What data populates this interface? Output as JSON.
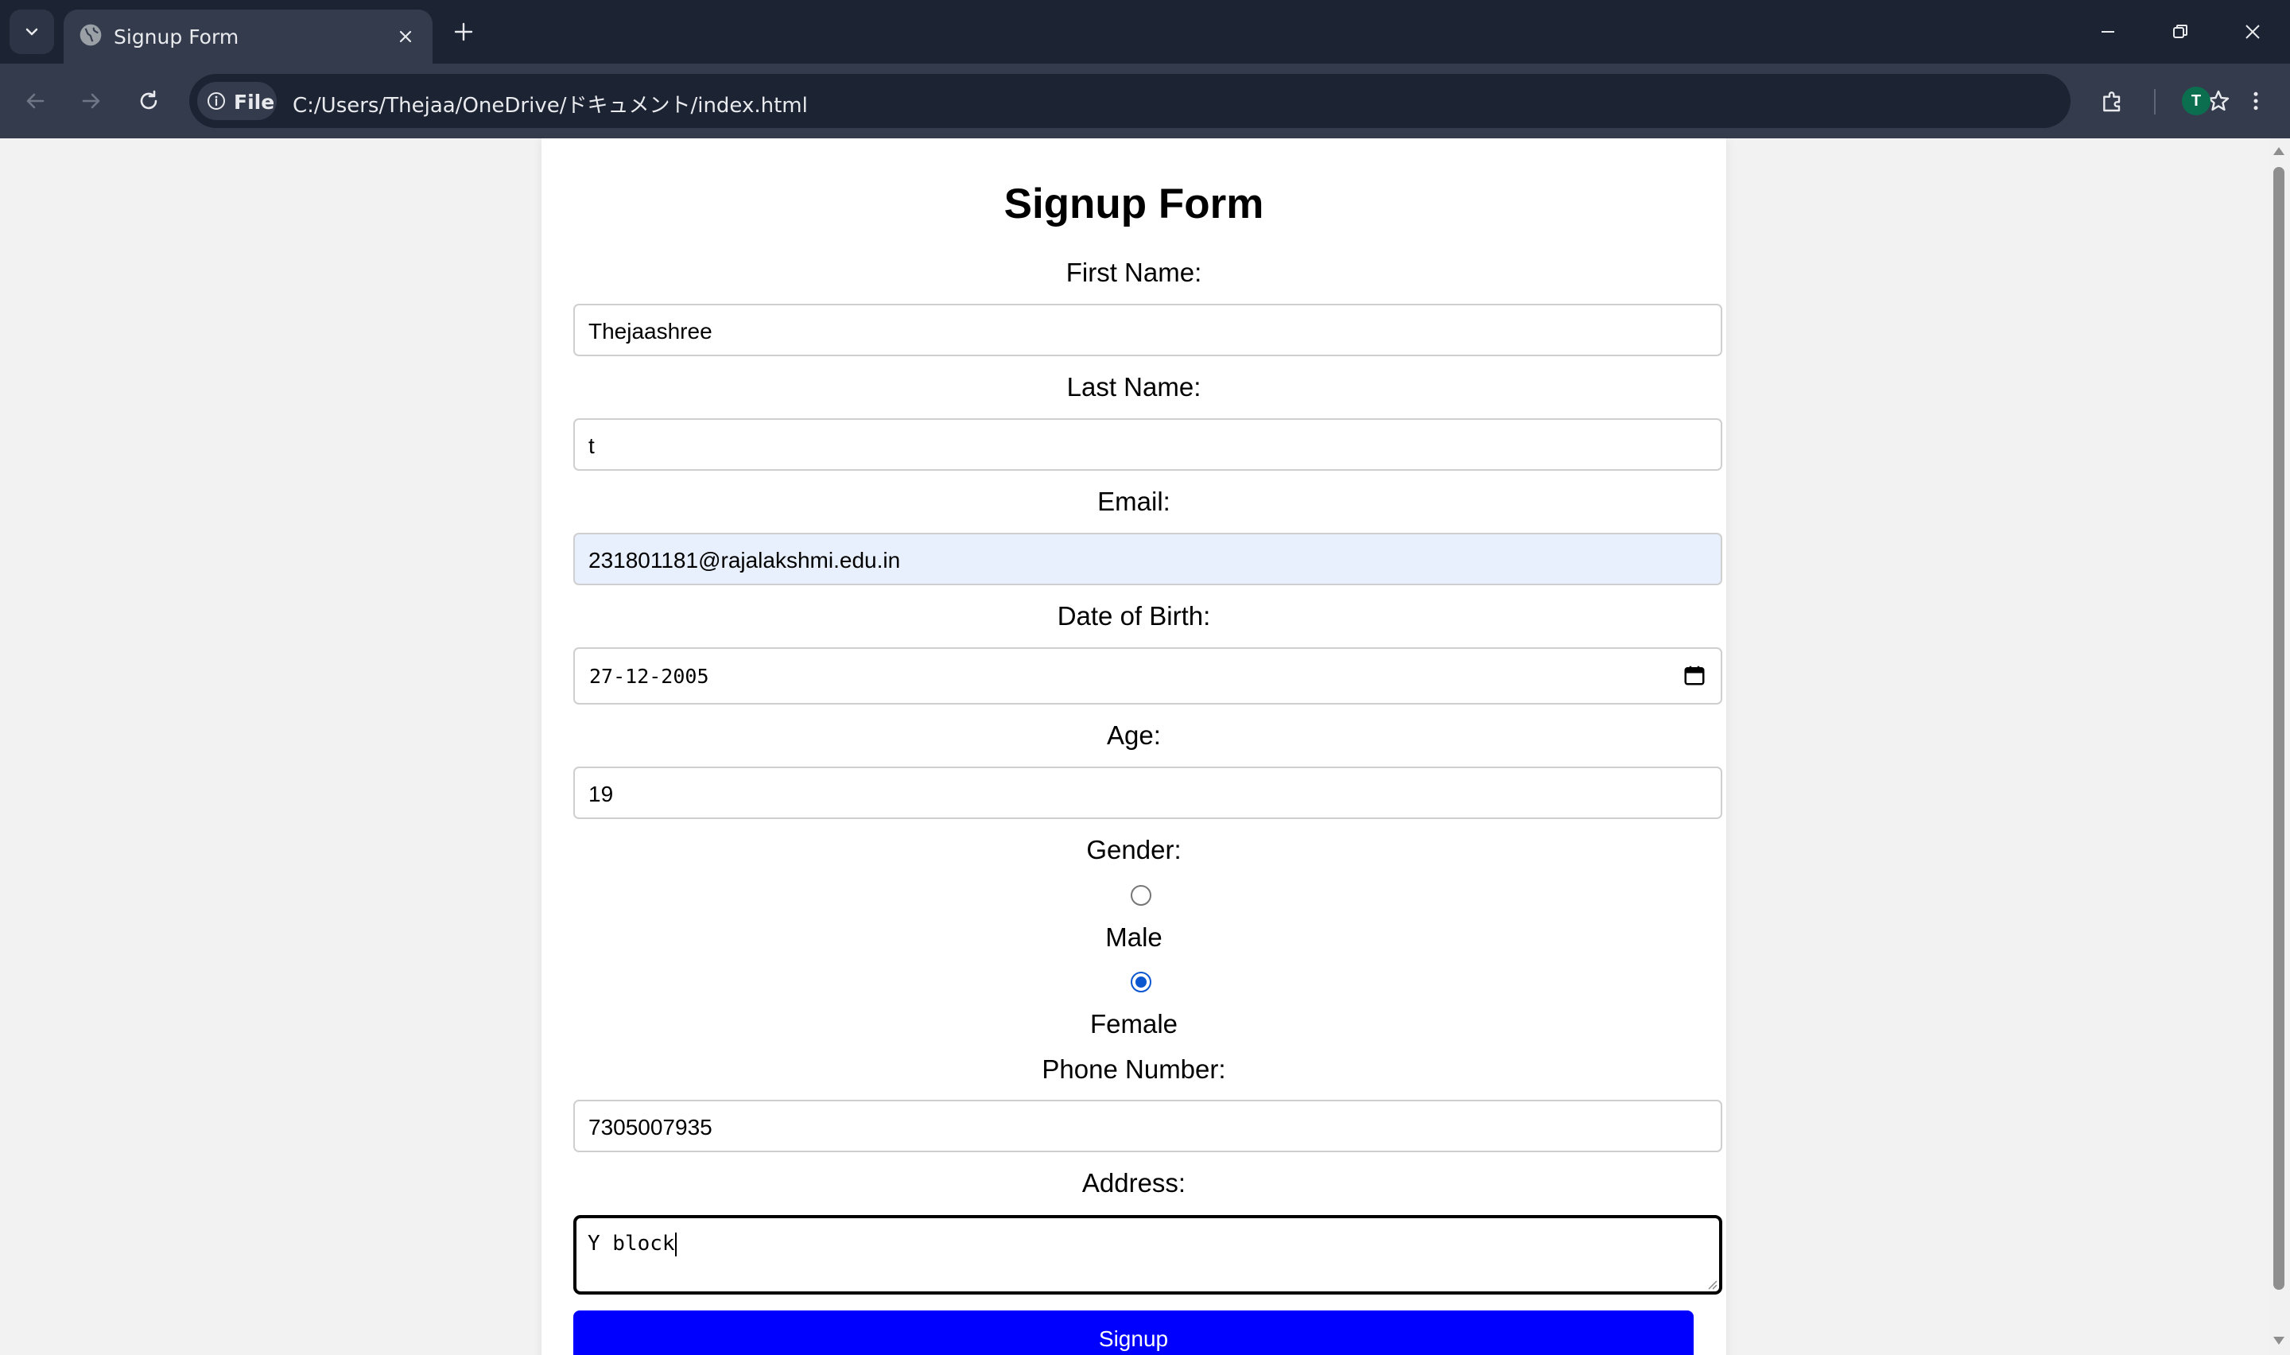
{
  "browser": {
    "tab_title": "Signup Form",
    "site_chip_label": "File",
    "url": "C:/Users/Thejaa/OneDrive/ドキュメント/index.html",
    "profile_initial": "T"
  },
  "form": {
    "title": "Signup Form",
    "first_name": {
      "label": "First Name:",
      "value": "Thejaashree"
    },
    "last_name": {
      "label": "Last Name:",
      "value": "t"
    },
    "email": {
      "label": "Email:",
      "value": "231801181@rajalakshmi.edu.in"
    },
    "dob": {
      "label": "Date of Birth:",
      "value": "27-12-2005"
    },
    "age": {
      "label": "Age:",
      "value": "19"
    },
    "gender": {
      "label": "Gender:",
      "options": [
        {
          "label": "Male",
          "checked": false
        },
        {
          "label": "Female",
          "checked": true
        }
      ]
    },
    "phone": {
      "label": "Phone Number:",
      "value": "7305007935"
    },
    "address": {
      "label": "Address:",
      "value": "Y block"
    },
    "submit_label": "Signup"
  },
  "colors": {
    "titlebar": "#1c2333",
    "toolbar": "#343b4d",
    "submit_button": "#0000ff",
    "autofill": "#e8f0fe",
    "radio_checked": "#0b57d0"
  }
}
